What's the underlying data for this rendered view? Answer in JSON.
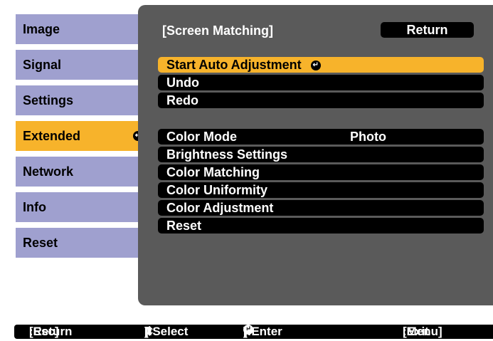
{
  "sidebar": {
    "items": [
      {
        "label": "Image"
      },
      {
        "label": "Signal"
      },
      {
        "label": "Settings"
      },
      {
        "label": "Extended",
        "active": true
      },
      {
        "label": "Network"
      },
      {
        "label": "Info"
      },
      {
        "label": "Reset"
      }
    ]
  },
  "panel": {
    "title": "[Screen Matching]",
    "return_label": "Return",
    "group1": [
      {
        "label": "Start Auto Adjustment",
        "selected": true
      },
      {
        "label": "Undo"
      },
      {
        "label": "Redo"
      }
    ],
    "group2": [
      {
        "label": "Color Mode",
        "value": "Photo"
      },
      {
        "label": "Brightness Settings"
      },
      {
        "label": "Color Matching"
      },
      {
        "label": "Color Uniformity"
      },
      {
        "label": "Color Adjustment"
      },
      {
        "label": "Reset"
      }
    ]
  },
  "footer": {
    "esc_key": "[Esc]",
    "esc_action": ":Return",
    "select_open": "[",
    "select_close": "]:Select",
    "enter_open": "[",
    "enter_close": "]:Enter",
    "menu_key": "[Menu]",
    "menu_action": ":Exit"
  },
  "icons": {
    "enter": "enter-icon",
    "updown": "up-down-arrow-icon"
  },
  "colors": {
    "highlight": "#f7b32b",
    "sidebar": "#9fa0cf",
    "panel": "#5a5a5a",
    "row": "#000000"
  }
}
